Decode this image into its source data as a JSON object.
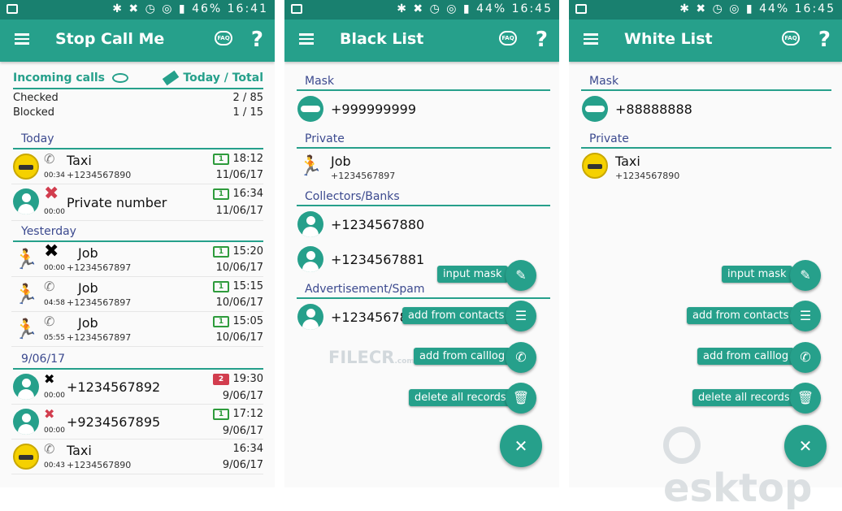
{
  "status_bar": [
    {
      "battery": "46%",
      "time": "16:41"
    },
    {
      "battery": "44%",
      "time": "16:45"
    },
    {
      "battery": "44%",
      "time": "16:45"
    }
  ],
  "screen1": {
    "title": "Stop Call Me",
    "incoming_label": "Incoming calls",
    "today_total_label": "Today / Total",
    "stats": [
      {
        "label": "Checked",
        "value": "2 / 85"
      },
      {
        "label": "Blocked",
        "value": "1 / 15"
      }
    ],
    "sections": [
      "Today",
      "Yesterday",
      "9/06/17"
    ],
    "calls": [
      {
        "name": "Taxi",
        "number": "+1234567890",
        "duration": "00:34",
        "sim": "1",
        "time": "18:12",
        "date": "11/06/17"
      },
      {
        "name": "Private number",
        "number": "",
        "duration": "00:00",
        "sim": "1",
        "time": "16:34",
        "date": "11/06/17"
      },
      {
        "name": "Job",
        "number": "+1234567897",
        "duration": "00:00",
        "sim": "1",
        "time": "15:20",
        "date": "10/06/17"
      },
      {
        "name": "Job",
        "number": "+1234567897",
        "duration": "04:58",
        "sim": "1",
        "time": "15:15",
        "date": "10/06/17"
      },
      {
        "name": "Job",
        "number": "+1234567897",
        "duration": "05:55",
        "sim": "1",
        "time": "15:05",
        "date": "10/06/17"
      },
      {
        "name": "+1234567892",
        "number": "",
        "duration": "00:00",
        "sim": "2",
        "time": "19:30",
        "date": "9/06/17"
      },
      {
        "name": "+9234567895",
        "number": "",
        "duration": "00:00",
        "sim": "1",
        "time": "17:12",
        "date": "9/06/17"
      },
      {
        "name": "Taxi",
        "number": "+1234567890",
        "duration": "00:43",
        "sim": "",
        "time": "16:34",
        "date": "9/06/17"
      }
    ]
  },
  "screen2": {
    "title": "Black List",
    "sections": [
      "Mask",
      "Private",
      "Collectors/Banks",
      "Advertisement/Spam"
    ],
    "entries": [
      {
        "name": "+999999999",
        "number": ""
      },
      {
        "name": "Job",
        "number": "+1234567897"
      },
      {
        "name": "+1234567880",
        "number": ""
      },
      {
        "name": "+1234567881",
        "number": ""
      },
      {
        "name": "+12345678",
        "number": ""
      }
    ]
  },
  "screen3": {
    "title": "White List",
    "sections": [
      "Mask",
      "Private"
    ],
    "entries": [
      {
        "name": "+88888888",
        "number": ""
      },
      {
        "name": "Taxi",
        "number": "+1234567890"
      }
    ]
  },
  "fab_menu": {
    "input_mask": "input mask",
    "add_from_contacts": "add from contacts",
    "add_from_calllog": "add from calllog",
    "delete_all": "delete all records",
    "close": "✕"
  },
  "icons": {
    "menu": "menu-icon",
    "faq": "faq-icon",
    "help": "help-icon",
    "eye": "eye-icon",
    "eraser": "eraser-icon",
    "pencil": "pencil-icon",
    "contacts": "contacts-icon",
    "phone": "phone-icon",
    "trash": "trash-icon"
  },
  "watermarks": {
    "filecr": "FILECR",
    "filecr_sub": ".com",
    "desktop": "esktop"
  },
  "colors": {
    "accent": "#26a08b",
    "dark": "#19806f",
    "section_text": "#3c4a8f",
    "sim1": "#2e9b3c",
    "sim2": "#d23d4e"
  }
}
